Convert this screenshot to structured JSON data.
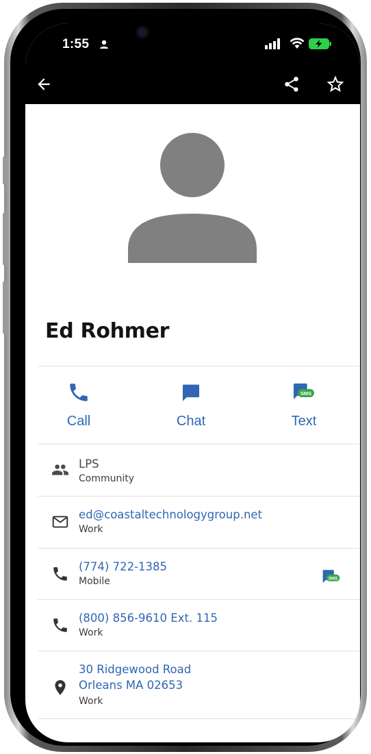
{
  "status_bar": {
    "time": "1:55"
  },
  "app_bar": {
    "back_icon": "arrow-left-icon",
    "share_icon": "share-icon",
    "favorite_icon": "star-outline-icon"
  },
  "contact": {
    "name": "Ed Rohmer"
  },
  "actions": [
    {
      "label": "Call",
      "icon": "phone-icon"
    },
    {
      "label": "Chat",
      "icon": "chat-bubble-icon"
    },
    {
      "label": "Text",
      "icon": "sms-icon"
    }
  ],
  "details": [
    {
      "primary": "LPS",
      "secondary": "Community",
      "icon": "group-icon"
    },
    {
      "primary": "ed@coastaltechnologygroup.net",
      "secondary": "Work",
      "icon": "mail-icon"
    },
    {
      "primary": "(774) 722-1385",
      "secondary": "Mobile",
      "icon": "phone-icon",
      "badge": "SMS"
    },
    {
      "primary": "(800) 856-9610 Ext. 115",
      "secondary": "Work",
      "icon": "phone-icon"
    },
    {
      "primary_line1": "30 Ridgewood Road",
      "primary_line2": "Orleans MA 02653",
      "secondary": "Work",
      "icon": "location-pin-icon"
    }
  ],
  "colors": {
    "accent": "#2f67b4",
    "sms_green": "#3aa54a",
    "avatar_gray": "#808080"
  }
}
